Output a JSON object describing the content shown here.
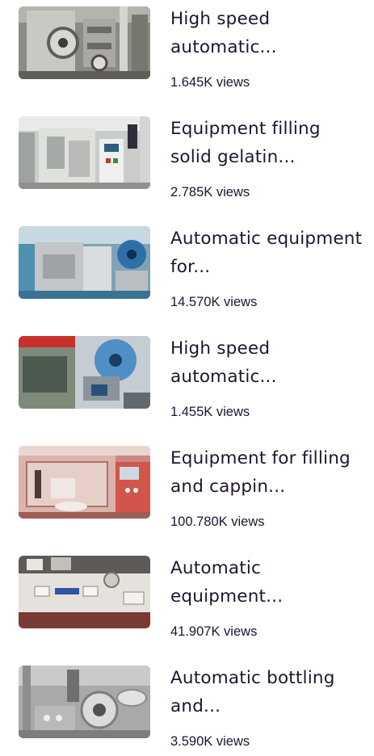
{
  "videos": [
    {
      "title": "High speed automatic...",
      "views": "1.645K views",
      "thumb": "machine-thumbnail-1"
    },
    {
      "title": "Equipment filling solid gelatin...",
      "views": "2.785K views",
      "thumb": "machine-thumbnail-2"
    },
    {
      "title": "Automatic equipment for...",
      "views": "14.570K views",
      "thumb": "machine-thumbnail-3"
    },
    {
      "title": "High speed automatic...",
      "views": "1.455K views",
      "thumb": "machine-thumbnail-4"
    },
    {
      "title": "Equipment for filling and cappin...",
      "views": "100.780K views",
      "thumb": "machine-thumbnail-5"
    },
    {
      "title": "Automatic equipment...",
      "views": "41.907K views",
      "thumb": "machine-thumbnail-6"
    },
    {
      "title": "Automatic bottling and...",
      "views": "3.590K views",
      "thumb": "machine-thumbnail-7"
    }
  ]
}
